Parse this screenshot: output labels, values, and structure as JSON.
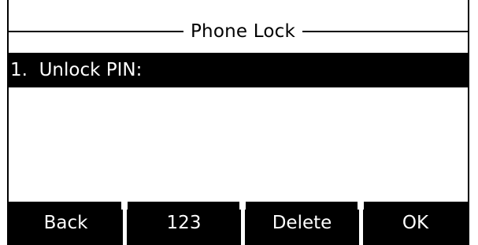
{
  "screen": {
    "title": "Phone Lock"
  },
  "list": {
    "items": [
      {
        "label": "1.  Unlock PIN:",
        "selected": true
      }
    ]
  },
  "softkeys": {
    "back": "Back",
    "input_mode": "123",
    "delete": "Delete",
    "ok": "OK"
  },
  "colors": {
    "highlight_bg": "#000000",
    "highlight_fg": "#ffffff",
    "background": "#ffffff"
  }
}
